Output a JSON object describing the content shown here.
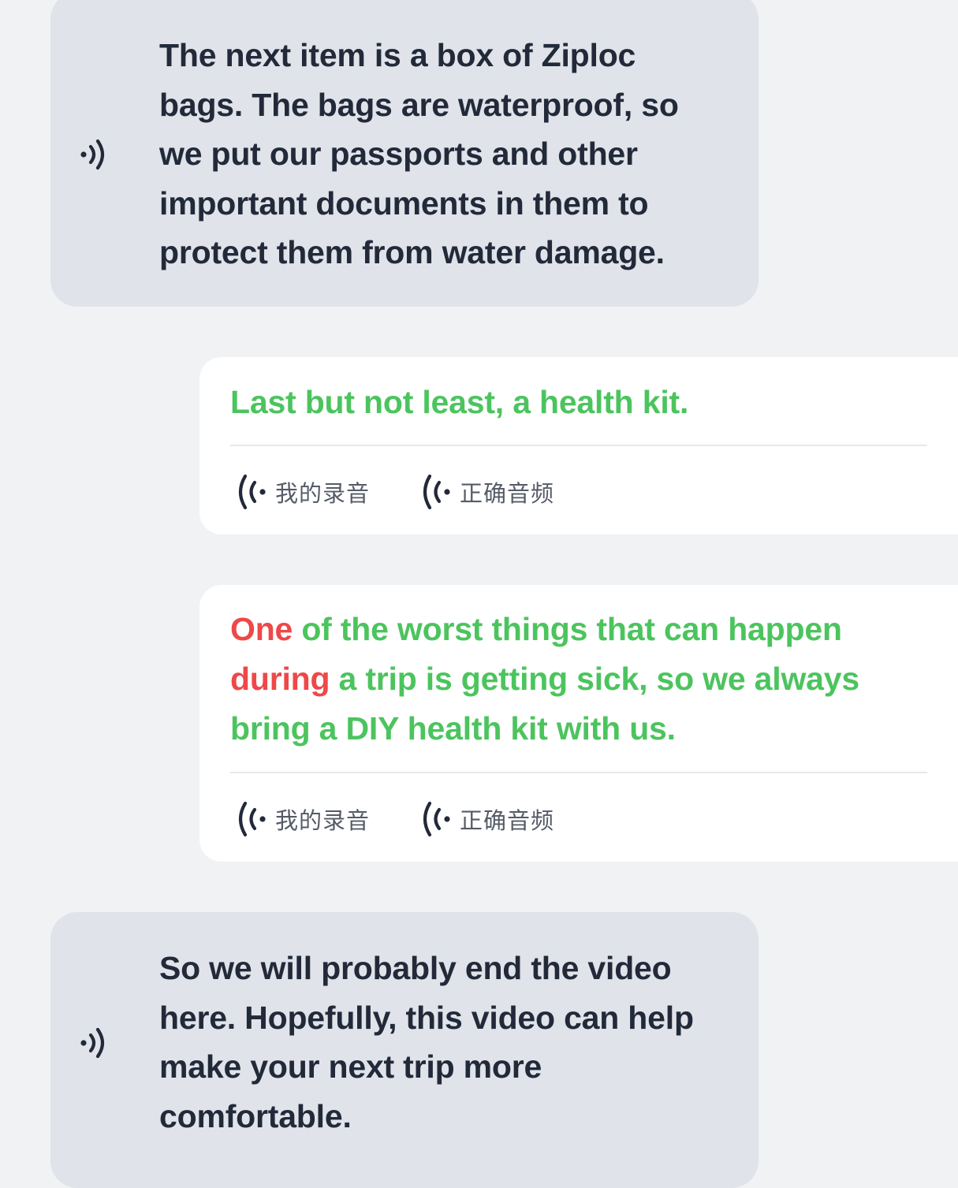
{
  "messages": [
    {
      "type": "speaker",
      "icon": "speaker-icon",
      "text": "The next item is a box of Ziploc bags. The bags are waterproof, so we put our passports and other important documents in them to protect them from water damage."
    },
    {
      "type": "user",
      "segments": [
        {
          "text": "Last but not least, a health kit.",
          "status": "correct"
        }
      ],
      "my_recording_label": "我的录音",
      "correct_audio_label": "正确音频"
    },
    {
      "type": "user",
      "segments": [
        {
          "text": "One",
          "status": "incorrect"
        },
        {
          "text": " of the worst things that can happen ",
          "status": "correct"
        },
        {
          "text": "during",
          "status": "incorrect"
        },
        {
          "text": " a trip is getting sick, so we always bring a DIY health kit with us.",
          "status": "correct"
        }
      ],
      "my_recording_label": "我的录音",
      "correct_audio_label": "正确音频"
    },
    {
      "type": "speaker",
      "icon": "speaker-icon",
      "text": "So we will probably end the video here. Hopefully, this video can help make your next trip more comfortable."
    }
  ],
  "colors": {
    "correct": "#4cc45e",
    "incorrect": "#ee4848",
    "bubble_bg": "#e0e3e9",
    "card_bg": "#ffffff",
    "page_bg": "#f1f2f4"
  }
}
